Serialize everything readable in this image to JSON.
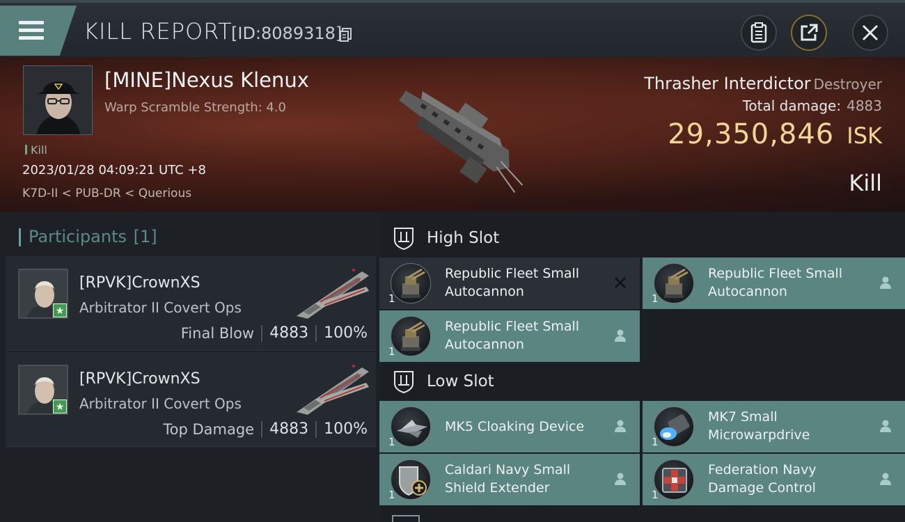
{
  "header": {
    "title": "KILL REPORT",
    "report_id": "[ID:8089318]",
    "icons": {
      "menu": "hamburger-menu-icon",
      "copy": "copy-icon",
      "clipboard": "clipboard-icon",
      "share": "share-icon",
      "close": "close-icon"
    }
  },
  "victim": {
    "name": "[MINE]Nexus Klenux",
    "warp_scramble": "Warp Scramble Strength: 4.0",
    "kill_tag": "Kill",
    "datetime": "2023/01/28 04:09:21 UTC +8",
    "location": "K7D-II < PUB-DR < Querious",
    "ship_name": "Thrasher Interdictor",
    "ship_class": "Destroyer",
    "total_damage_label": "Total damage:",
    "total_damage": "4883",
    "isk_value": "29,350,846",
    "isk_unit": "ISK",
    "result": "Kill"
  },
  "participants": {
    "title": "Participants",
    "count": "[1]",
    "rows": [
      {
        "name": "[RPVK]CrownXS",
        "ship": "Arbitrator II Covert Ops",
        "role": "Final Blow",
        "damage": "4883",
        "percent": "100%"
      },
      {
        "name": "[RPVK]CrownXS",
        "ship": "Arbitrator II Covert Ops",
        "role": "Top Damage",
        "damage": "4883",
        "percent": "100%"
      }
    ]
  },
  "slots": {
    "high": {
      "title": "High Slot",
      "items": [
        {
          "name": "Republic Fleet Small Autocannon",
          "qty": "1",
          "state": "destroyed",
          "icon": "autocannon-icon"
        },
        {
          "name": "Republic Fleet Small Autocannon",
          "qty": "1",
          "state": "dropped",
          "icon": "autocannon-icon"
        },
        {
          "name": "Republic Fleet Small Autocannon",
          "qty": "1",
          "state": "dropped",
          "icon": "autocannon-icon"
        }
      ]
    },
    "low": {
      "title": "Low Slot",
      "items": [
        {
          "name": "MK5 Cloaking Device",
          "qty": "1",
          "state": "dropped",
          "icon": "cloaking-device-icon"
        },
        {
          "name": "MK7 Small Microwarpdrive",
          "qty": "1",
          "state": "dropped",
          "icon": "microwarpdrive-icon"
        },
        {
          "name": "Caldari Navy Small Shield Extender",
          "qty": "1",
          "state": "dropped",
          "icon": "shield-extender-icon"
        },
        {
          "name": "Federation Navy Damage Control",
          "qty": "1",
          "state": "dropped",
          "icon": "damage-control-icon"
        }
      ]
    }
  },
  "colors": {
    "accent": "#5a8580",
    "isk": "#f3d596",
    "panel": "#1d2126"
  }
}
